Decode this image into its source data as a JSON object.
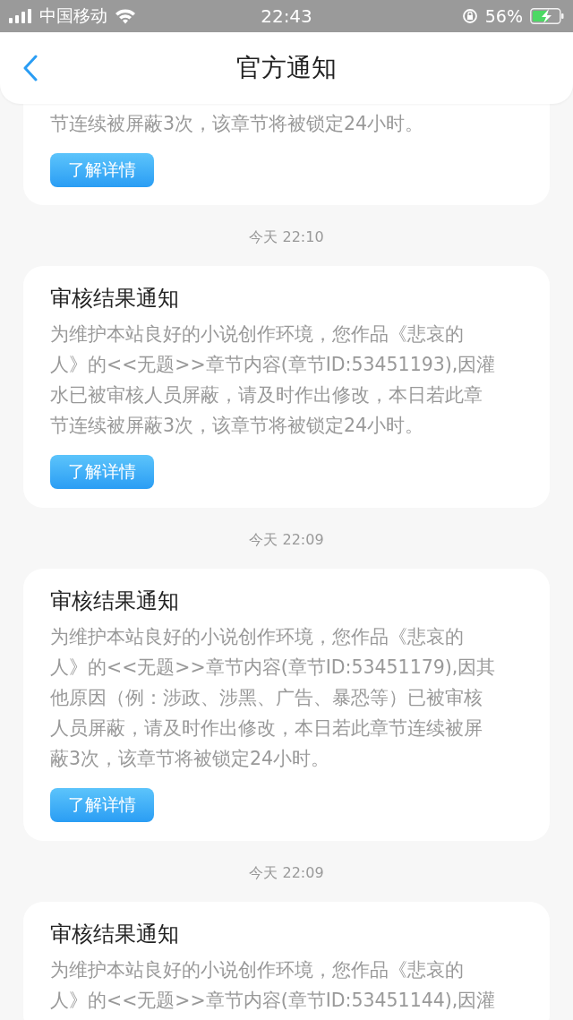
{
  "status_bar": {
    "carrier": "中国移动",
    "time": "22:43",
    "battery": "56%"
  },
  "header": {
    "title": "官方通知"
  },
  "notices": [
    {
      "lines": [
        "节连续被屏蔽3次，该章节将被锁定24小时。"
      ],
      "button": "了解详情"
    },
    {
      "timestamp": "今天 22:10",
      "title": "审核结果通知",
      "lines": [
        "为维护本站良好的小说创作环境，您作品《悲哀的",
        "人》的<<无题>>章节内容(章节ID:53451193),因灌",
        "水已被审核人员屏蔽，请及时作出修改，本日若此章",
        "节连续被屏蔽3次，该章节将被锁定24小时。"
      ],
      "button": "了解详情"
    },
    {
      "timestamp": "今天 22:09",
      "title": "审核结果通知",
      "lines": [
        "为维护本站良好的小说创作环境，您作品《悲哀的",
        "人》的<<无题>>章节内容(章节ID:53451179),因其",
        "他原因（例：涉政、涉黑、广告、暴恐等）已被审核",
        "人员屏蔽，请及时作出修改，本日若此章节连续被屏",
        "蔽3次，该章节将被锁定24小时。"
      ],
      "button": "了解详情"
    },
    {
      "timestamp": "今天 22:09",
      "title": "审核结果通知",
      "lines": [
        "为维护本站良好的小说创作环境，您作品《悲哀的",
        "人》的<<无题>>章节内容(章节ID:53451144),因灌"
      ]
    }
  ]
}
